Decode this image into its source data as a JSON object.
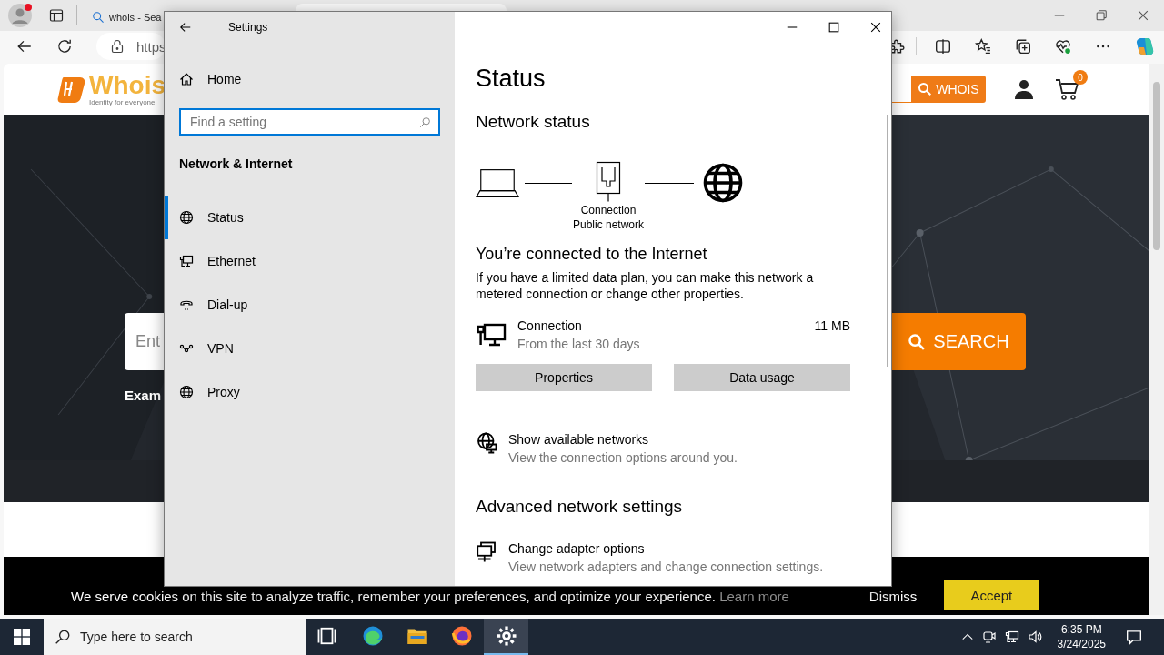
{
  "browser": {
    "tabs": [
      {
        "title": "whois - Sea",
        "selected": false
      },
      {
        "selected": true
      }
    ],
    "address": "https",
    "site": {
      "logo": "Whois",
      "tagline": "Identity for everyone",
      "whois_button": "WHOIS",
      "cart_count": "0",
      "search_placeholder": "Ent",
      "search_button": "SEARCH",
      "example": "Exam",
      "cookie": {
        "text": "We serve cookies on this site to analyze traffic, remember your preferences, and optimize your experience.",
        "link": "Learn more",
        "dismiss": "Dismiss",
        "accept": "Accept"
      }
    }
  },
  "settings": {
    "title": "Settings",
    "home": "Home",
    "search_placeholder": "Find a setting",
    "section": "Network & Internet",
    "nav": [
      {
        "label": "Status",
        "selected": true
      },
      {
        "label": "Ethernet",
        "selected": false
      },
      {
        "label": "Dial-up",
        "selected": false
      },
      {
        "label": "VPN",
        "selected": false
      },
      {
        "label": "Proxy",
        "selected": false
      }
    ],
    "page": {
      "heading": "Status",
      "network_status": "Network status",
      "diagram": {
        "label": "Connection",
        "sublabel": "Public network"
      },
      "connected": "You’re connected to the Internet",
      "description": "If you have a limited data plan, you can make this network a metered connection or change other properties.",
      "connection": {
        "name": "Connection",
        "detail": "From the last 30 days",
        "usage": "11 MB"
      },
      "buttons": [
        "Properties",
        "Data usage"
      ],
      "links": [
        {
          "title": "Show available networks",
          "detail": "View the connection options around you."
        }
      ],
      "advanced_heading": "Advanced network settings",
      "advanced_links": [
        {
          "title": "Change adapter options",
          "detail": "View network adapters and change connection settings."
        }
      ]
    }
  },
  "taskbar": {
    "search_placeholder": "Type here to search",
    "apps": [
      {
        "selected": false
      },
      {
        "selected": false
      },
      {
        "selected": false
      },
      {
        "selected": false
      },
      {
        "selected": true
      }
    ],
    "time": "6:35 PM",
    "date": "3/24/2025"
  }
}
